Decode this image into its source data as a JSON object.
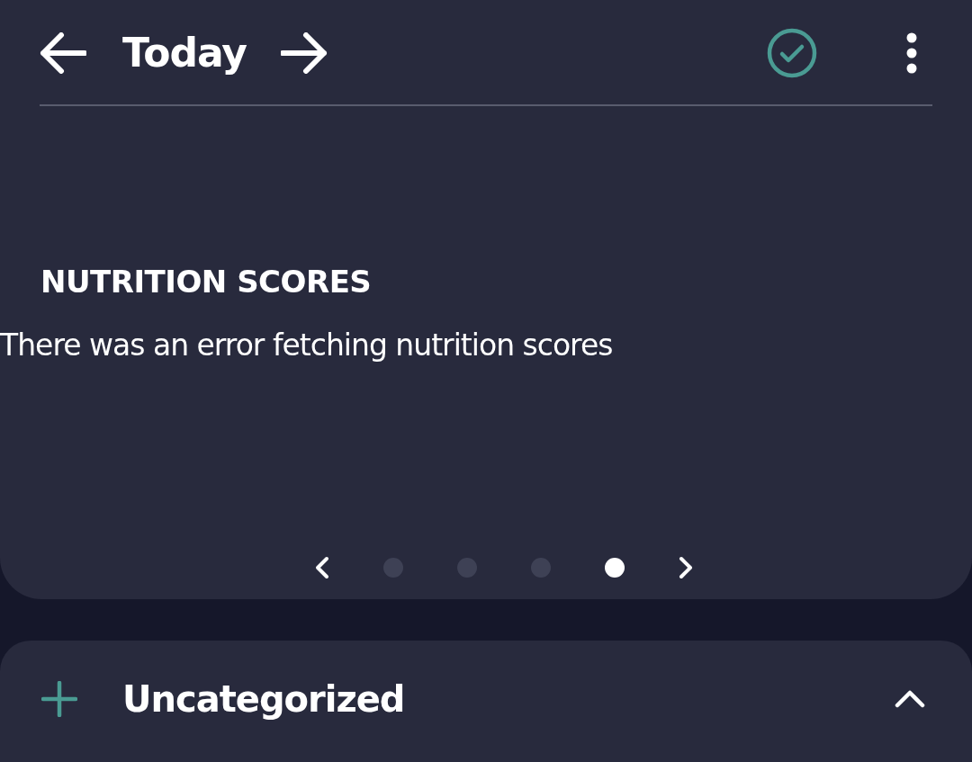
{
  "header": {
    "title": "Today"
  },
  "section": {
    "title": "NUTRITION SCORES",
    "message": "There was an error fetching nutrition scores"
  },
  "pager": [
    {
      "selected": false
    },
    {
      "selected": false
    },
    {
      "selected": false
    },
    {
      "selected": true
    }
  ],
  "category": {
    "name": "Uncategorized",
    "expanded": true
  }
}
